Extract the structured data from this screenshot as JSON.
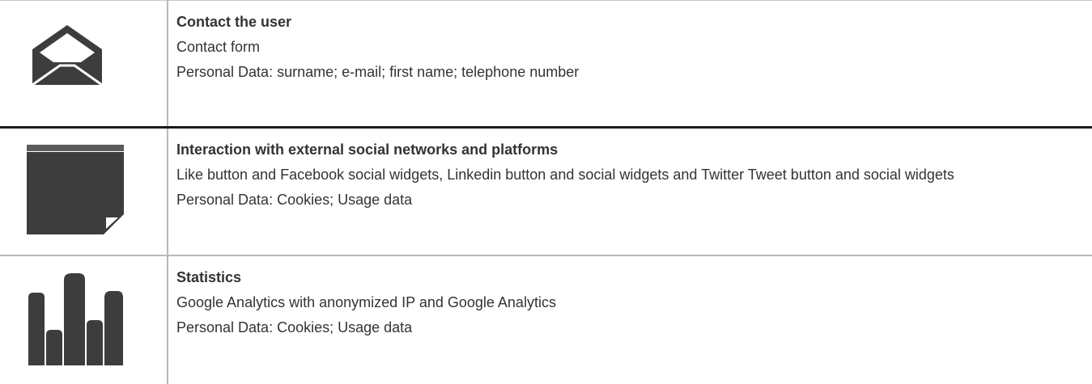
{
  "rows": [
    {
      "icon": "envelope-open-icon",
      "title": "Contact the user",
      "description": "Contact form",
      "personal_data": "Personal Data: surname; e-mail; first name; telephone number"
    },
    {
      "icon": "sticky-note-icon",
      "title": "Interaction with external social networks and platforms",
      "description": "Like button and Facebook social widgets, Linkedin button and social widgets and Twitter Tweet button and social widgets",
      "personal_data": "Personal Data: Cookies; Usage data"
    },
    {
      "icon": "bar-chart-icon",
      "title": "Statistics",
      "description": "Google Analytics with anonymized IP and Google Analytics",
      "personal_data": "Personal Data: Cookies; Usage data"
    }
  ],
  "colors": {
    "icon": "#3d3d3d",
    "text": "#333333",
    "border": "#b8b8b8",
    "separator": "#1a1a1a"
  }
}
